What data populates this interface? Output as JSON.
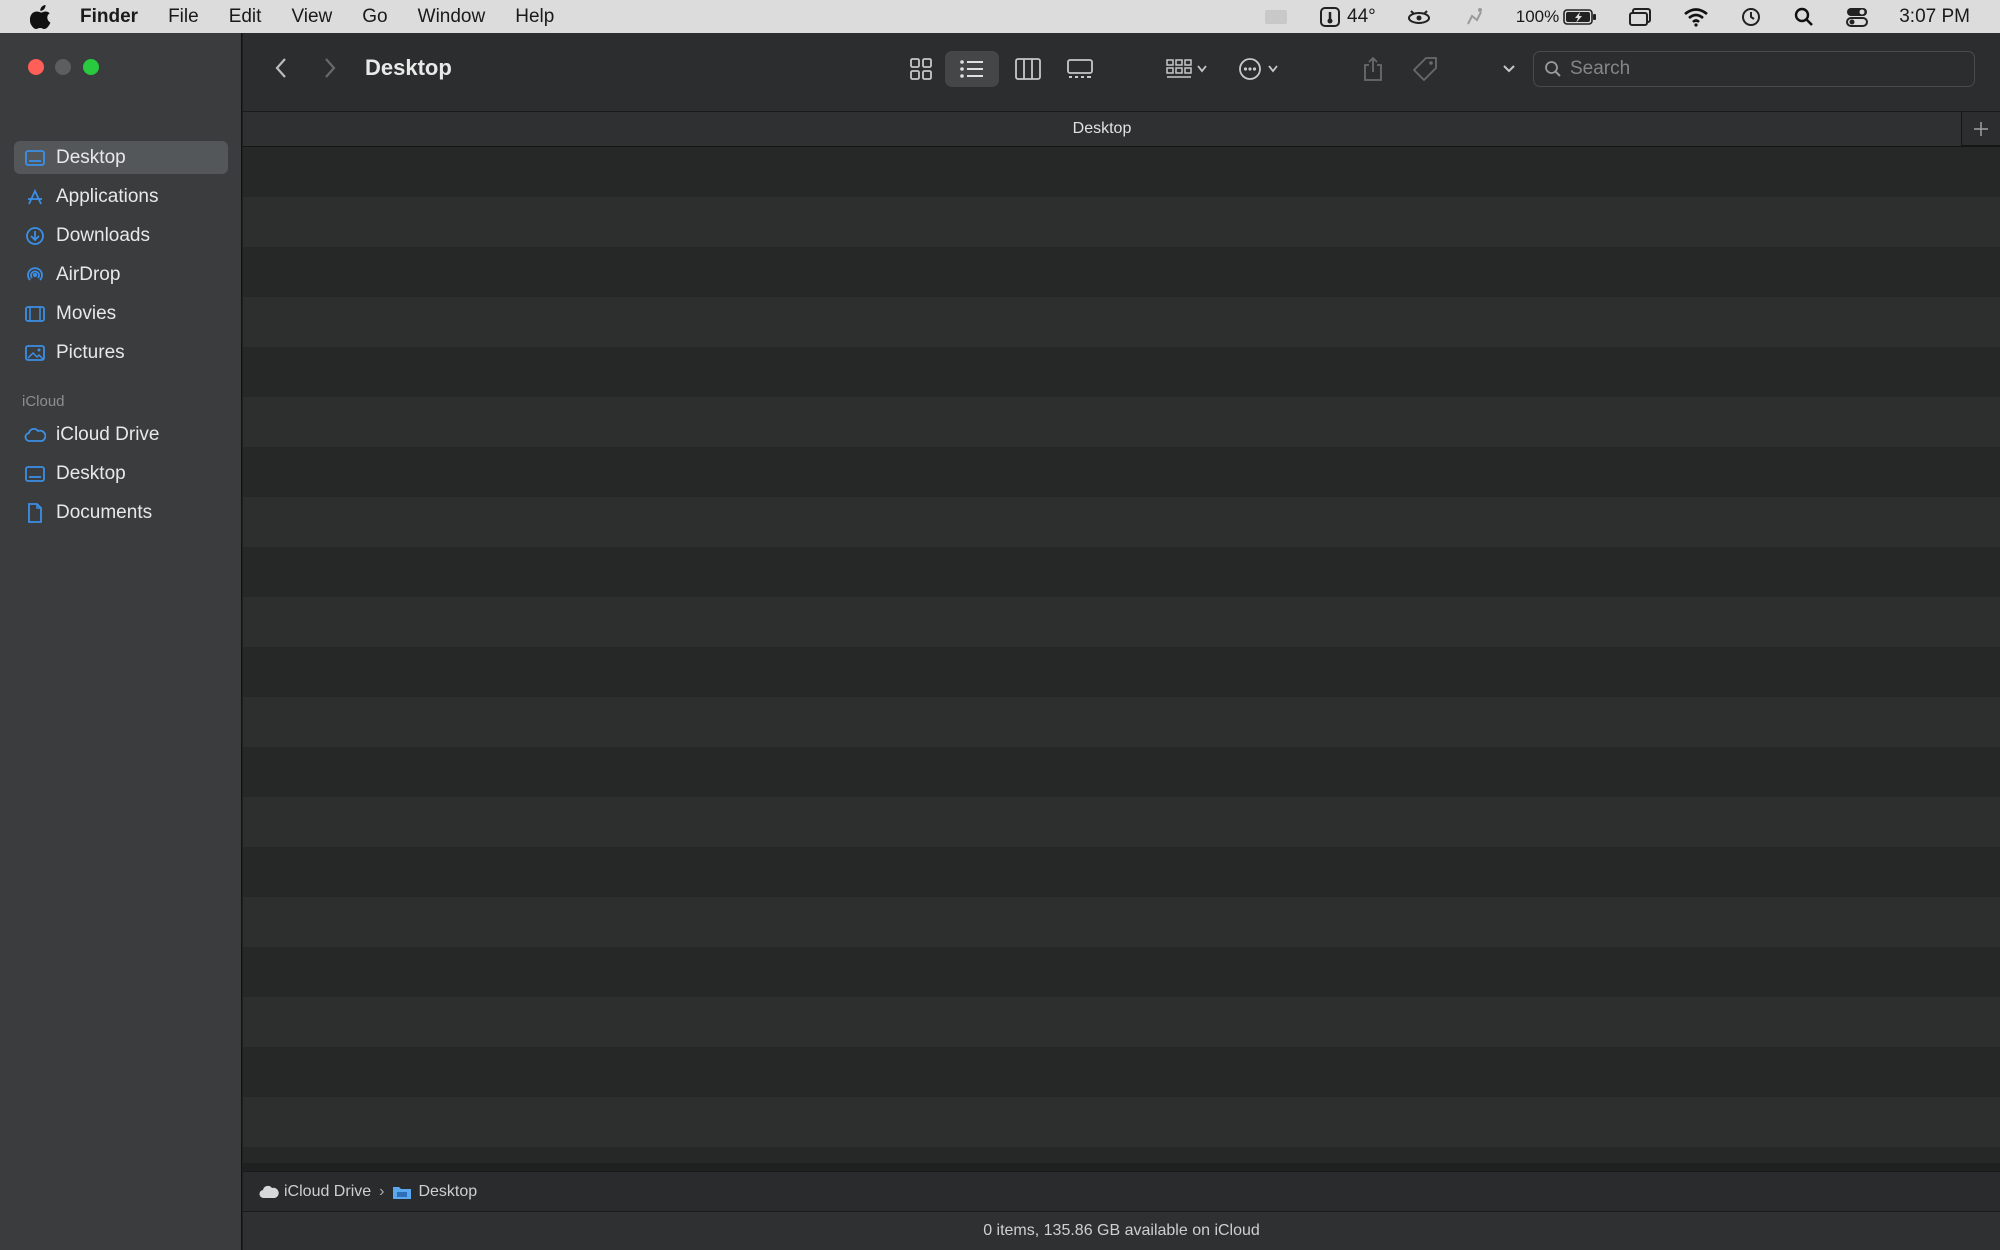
{
  "menubar": {
    "items": [
      "Finder",
      "File",
      "Edit",
      "View",
      "Go",
      "Window",
      "Help"
    ],
    "temperature": "44°",
    "battery": "100%",
    "clock": "3:07 PM"
  },
  "sidebar": {
    "favorites": [
      {
        "label": "Desktop",
        "icon": "desktop-icon",
        "selected": true
      },
      {
        "label": "Applications",
        "icon": "applications-icon"
      },
      {
        "label": "Downloads",
        "icon": "downloads-icon"
      },
      {
        "label": "AirDrop",
        "icon": "airdrop-icon"
      },
      {
        "label": "Movies",
        "icon": "movies-icon"
      },
      {
        "label": "Pictures",
        "icon": "pictures-icon"
      }
    ],
    "icloud_header": "iCloud",
    "icloud": [
      {
        "label": "iCloud Drive",
        "icon": "cloud-icon"
      },
      {
        "label": "Desktop",
        "icon": "desktop-icon"
      },
      {
        "label": "Documents",
        "icon": "document-icon"
      }
    ]
  },
  "toolbar": {
    "title": "Desktop",
    "search_placeholder": "Search"
  },
  "tab": {
    "label": "Desktop"
  },
  "pathbar": {
    "items": [
      "iCloud Drive",
      "Desktop"
    ]
  },
  "status": {
    "text": "0 items, 135.86 GB available on iCloud"
  },
  "colors": {
    "accent": "#3b8fe8",
    "selected_row": "#54575a"
  }
}
